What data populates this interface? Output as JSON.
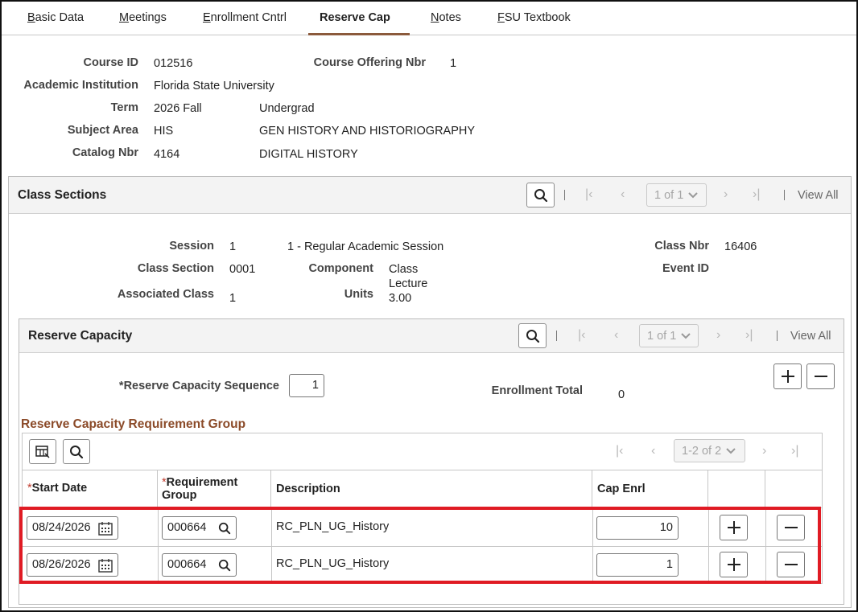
{
  "tabs": [
    {
      "label": "Basic Data",
      "key": "B"
    },
    {
      "label": "Meetings",
      "key": "M"
    },
    {
      "label": "Enrollment Cntrl",
      "key": "E"
    },
    {
      "label": "Reserve Cap"
    },
    {
      "label": "Notes",
      "key": "N"
    },
    {
      "label": "FSU Textbook",
      "key": "F"
    }
  ],
  "course": {
    "course_id_label": "Course ID",
    "course_id": "012516",
    "offering_label": "Course Offering Nbr",
    "offering": "1",
    "institution_label": "Academic Institution",
    "institution": "Florida State University",
    "term_label": "Term",
    "term": "2026 Fall",
    "career": "Undergrad",
    "subject_label": "Subject Area",
    "subject": "HIS",
    "subject_desc": "GEN HISTORY AND HISTORIOGRAPHY",
    "catalog_label": "Catalog Nbr",
    "catalog": "4164",
    "catalog_desc": "DIGITAL HISTORY"
  },
  "class_sections": {
    "title": "Class Sections",
    "pager": "1 of 1",
    "view_all": "View All",
    "session_label": "Session",
    "session": "1",
    "session_desc": "1 - Regular Academic Session",
    "class_nbr_label": "Class Nbr",
    "class_nbr": "16406",
    "section_label": "Class Section",
    "section": "0001",
    "component_label": "Component",
    "component_line1": "Class",
    "component_line2": "Lecture",
    "event_label": "Event ID",
    "assoc_label": "Associated Class",
    "assoc": "1",
    "units_label": "Units",
    "units": "3.00"
  },
  "reserve_capacity": {
    "title": "Reserve Capacity",
    "pager": "1 of 1",
    "view_all": "View All",
    "sequence_label": "*Reserve Capacity Sequence",
    "sequence": "1",
    "enroll_total_label": "Enrollment Total",
    "enroll_total": "0"
  },
  "req_group": {
    "title": "Reserve Capacity Requirement Group",
    "pager": "1-2 of 2",
    "columns": {
      "start_date": "Start Date",
      "req_group_line1": "Requirement",
      "req_group_line2": "Group",
      "description": "Description",
      "cap_enrl": "Cap Enrl"
    },
    "rows": [
      {
        "start_date": "08/24/2026",
        "req_group": "000664",
        "description": "RC_PLN_UG_History",
        "cap_enrl": "10"
      },
      {
        "start_date": "08/26/2026",
        "req_group": "000664",
        "description": "RC_PLN_UG_History",
        "cap_enrl": "1"
      }
    ]
  },
  "icons": {
    "search": "search-icon",
    "first": "first-page-icon",
    "prev": "previous-page-icon",
    "next": "next-page-icon",
    "last": "last-page-icon",
    "add": "plus-icon",
    "delete": "minus-icon",
    "calendar": "calendar-icon",
    "personalize": "personalize-grid-icon"
  },
  "colors": {
    "tab_active": "#8b5a3c",
    "section_title": "#8b4a28",
    "highlight": "#e01b24"
  }
}
